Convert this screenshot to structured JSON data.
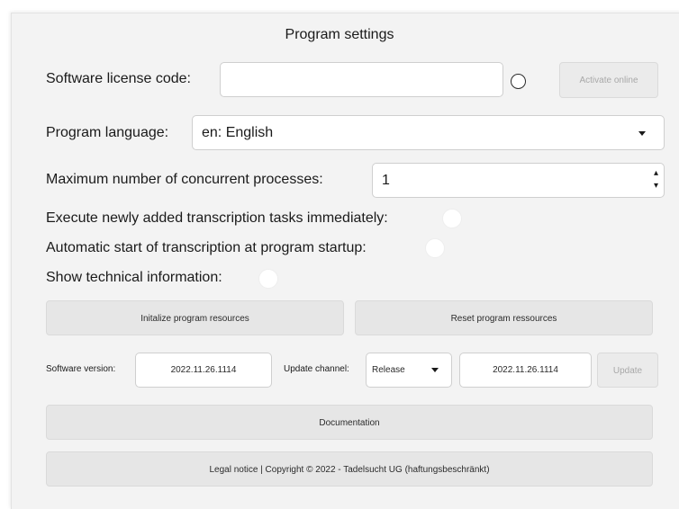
{
  "title": "Program settings",
  "license": {
    "label": "Software license code:",
    "value": "",
    "activate_label": "Activate online"
  },
  "language": {
    "label": "Program language:",
    "selected": "en: English"
  },
  "processes": {
    "label": "Maximum number of concurrent processes:",
    "value": "1"
  },
  "toggles": {
    "execute_immediately": "Execute newly added transcription tasks immediately:",
    "auto_start": "Automatic start of transcription at program startup:",
    "show_technical": "Show technical information:"
  },
  "resources": {
    "init_label": "Initalize program resources",
    "reset_label": "Reset program ressources"
  },
  "version": {
    "software_label": "Software version:",
    "software_value": "2022.11.26.1114",
    "channel_label": "Update channel:",
    "channel_selected": "Release",
    "latest_value": "2022.11.26.1114",
    "update_label": "Update"
  },
  "documentation_label": "Documentation",
  "legal_label": "Legal notice | Copyright © 2022 - Tadelsucht UG (haftungsbeschränkt)"
}
